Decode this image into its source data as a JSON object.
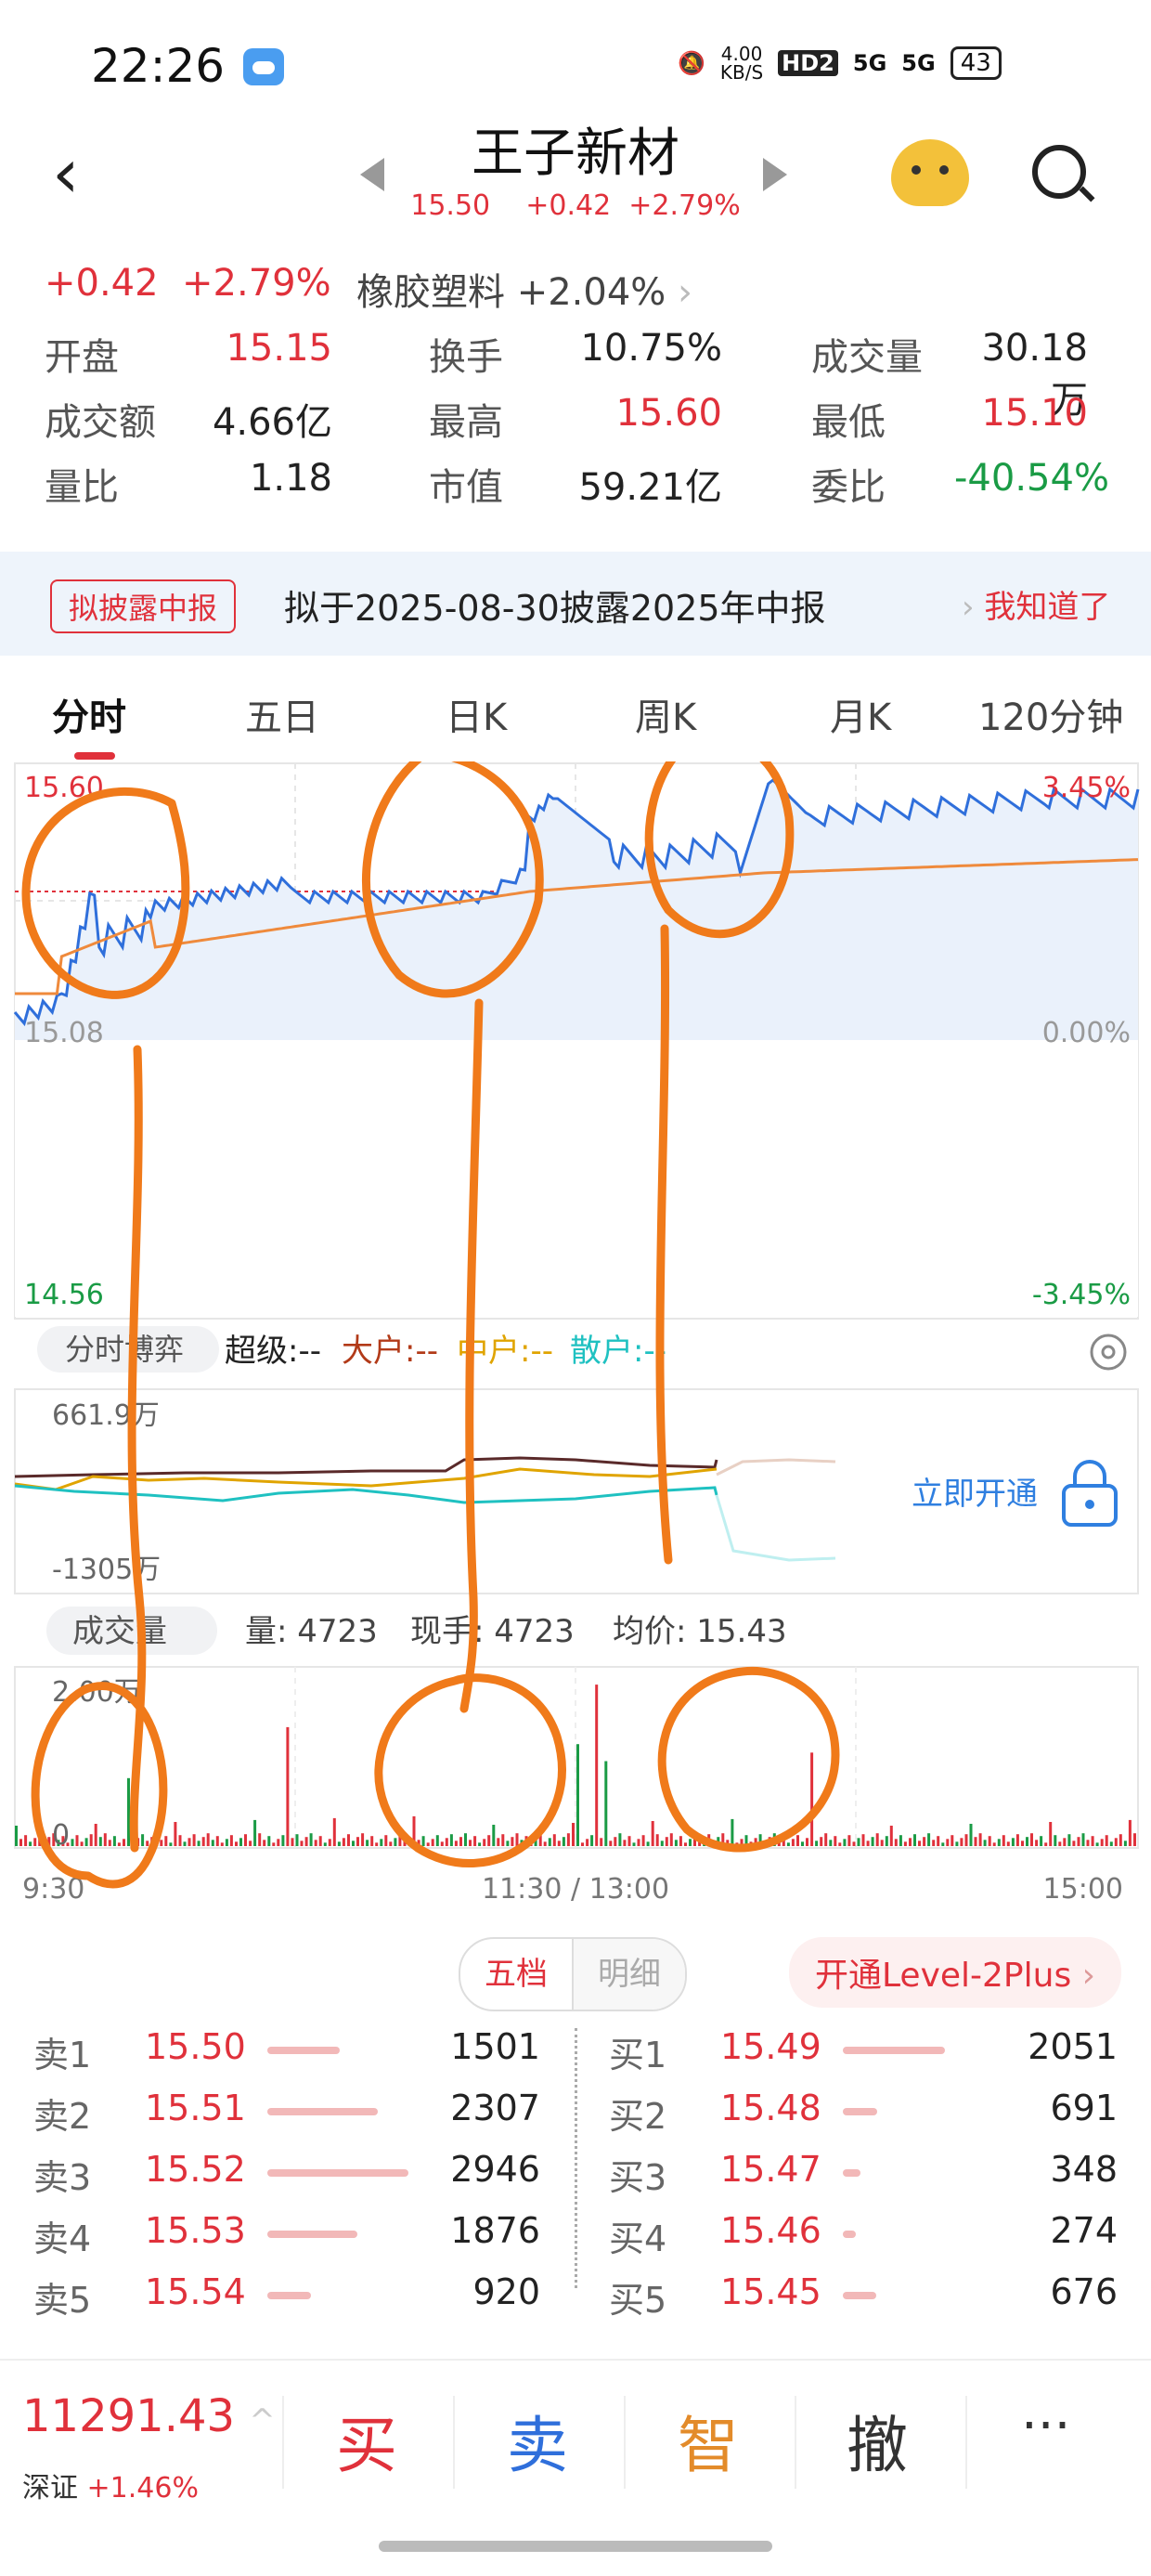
{
  "status": {
    "time": "22:26",
    "net_speed": "4.00",
    "net_unit": "KB/S",
    "hd": "HD2",
    "sig1": "5G",
    "sig2": "5G",
    "battery": "43"
  },
  "header": {
    "title": "王子新材",
    "price": "15.50",
    "change": "+0.42",
    "pct": "+2.79%"
  },
  "quote": {
    "change": "+0.42",
    "pct": "+2.79%",
    "sector_name": "橡胶塑料",
    "sector_pct": "+2.04%",
    "rows": [
      [
        {
          "label": "开盘",
          "value": "15.15",
          "color": "red"
        },
        {
          "label": "换手",
          "value": "10.75%",
          "color": "black"
        },
        {
          "label": "成交量",
          "value": "30.18万",
          "color": "black"
        }
      ],
      [
        {
          "label": "成交额",
          "value": "4.66亿",
          "color": "black"
        },
        {
          "label": "最高",
          "value": "15.60",
          "color": "red"
        },
        {
          "label": "最低",
          "value": "15.10",
          "color": "red"
        }
      ],
      [
        {
          "label": "量比",
          "value": "1.18",
          "color": "black"
        },
        {
          "label": "市值",
          "value": "59.21亿",
          "color": "black"
        },
        {
          "label": "委比",
          "value": "-40.54%",
          "color": "green"
        }
      ]
    ]
  },
  "notice": {
    "badge": "拟披露中报",
    "text": "拟于2025-08-30披露2025年中报",
    "button": "我知道了"
  },
  "tabs": [
    "分时",
    "五日",
    "日K",
    "周K",
    "月K",
    "120分钟"
  ],
  "intraday": {
    "y_top": "15.60",
    "y_mid": "15.08",
    "y_bottom": "14.56",
    "pct_top": "3.45%",
    "pct_mid": "0.00%",
    "pct_bottom": "-3.45%"
  },
  "flow": {
    "selector": "分时博弈",
    "super": "超级:--",
    "big": "大户:--",
    "mid": "中户:--",
    "small": "散户:--",
    "y_top": "661.9万",
    "y_bottom": "-1305万",
    "unlock": "立即开通"
  },
  "volume": {
    "selector": "成交量",
    "vol": "量: 4723",
    "hand": "现手: 4723",
    "avg": "均价: 15.43",
    "y_top": "2.00万",
    "y_zero": "0",
    "t_start": "9:30",
    "t_mid": "11:30 / 13:00",
    "t_end": "15:00"
  },
  "orderbook": {
    "tab_active": "五档",
    "tab_other": "明细",
    "level2": "开通Level-2Plus",
    "asks": [
      {
        "label": "卖1",
        "price": "15.50",
        "vol": "1501",
        "bar": 0.51
      },
      {
        "label": "卖2",
        "price": "15.51",
        "vol": "2307",
        "bar": 0.78
      },
      {
        "label": "卖3",
        "price": "15.52",
        "vol": "2946",
        "bar": 1.0
      },
      {
        "label": "卖4",
        "price": "15.53",
        "vol": "1876",
        "bar": 0.64
      },
      {
        "label": "卖5",
        "price": "15.54",
        "vol": "920",
        "bar": 0.31
      }
    ],
    "bids": [
      {
        "label": "买1",
        "price": "15.49",
        "vol": "2051",
        "bar": 1.0
      },
      {
        "label": "买2",
        "price": "15.48",
        "vol": "691",
        "bar": 0.34
      },
      {
        "label": "买3",
        "price": "15.47",
        "vol": "348",
        "bar": 0.17
      },
      {
        "label": "买4",
        "price": "15.46",
        "vol": "274",
        "bar": 0.13
      },
      {
        "label": "买5",
        "price": "15.45",
        "vol": "676",
        "bar": 0.33
      }
    ]
  },
  "bottom": {
    "index_value": "11291.43",
    "index_name": "深证",
    "index_pct": "+1.46%",
    "buy": "买",
    "sell": "卖",
    "smart": "智",
    "cancel": "撤",
    "more": "···"
  },
  "colors": {
    "up": "#e0313b",
    "down": "#1a9b45",
    "price_line": "#2f6fdb",
    "avg_line": "#ef8a3c",
    "annotation": "#f07a1a"
  }
}
